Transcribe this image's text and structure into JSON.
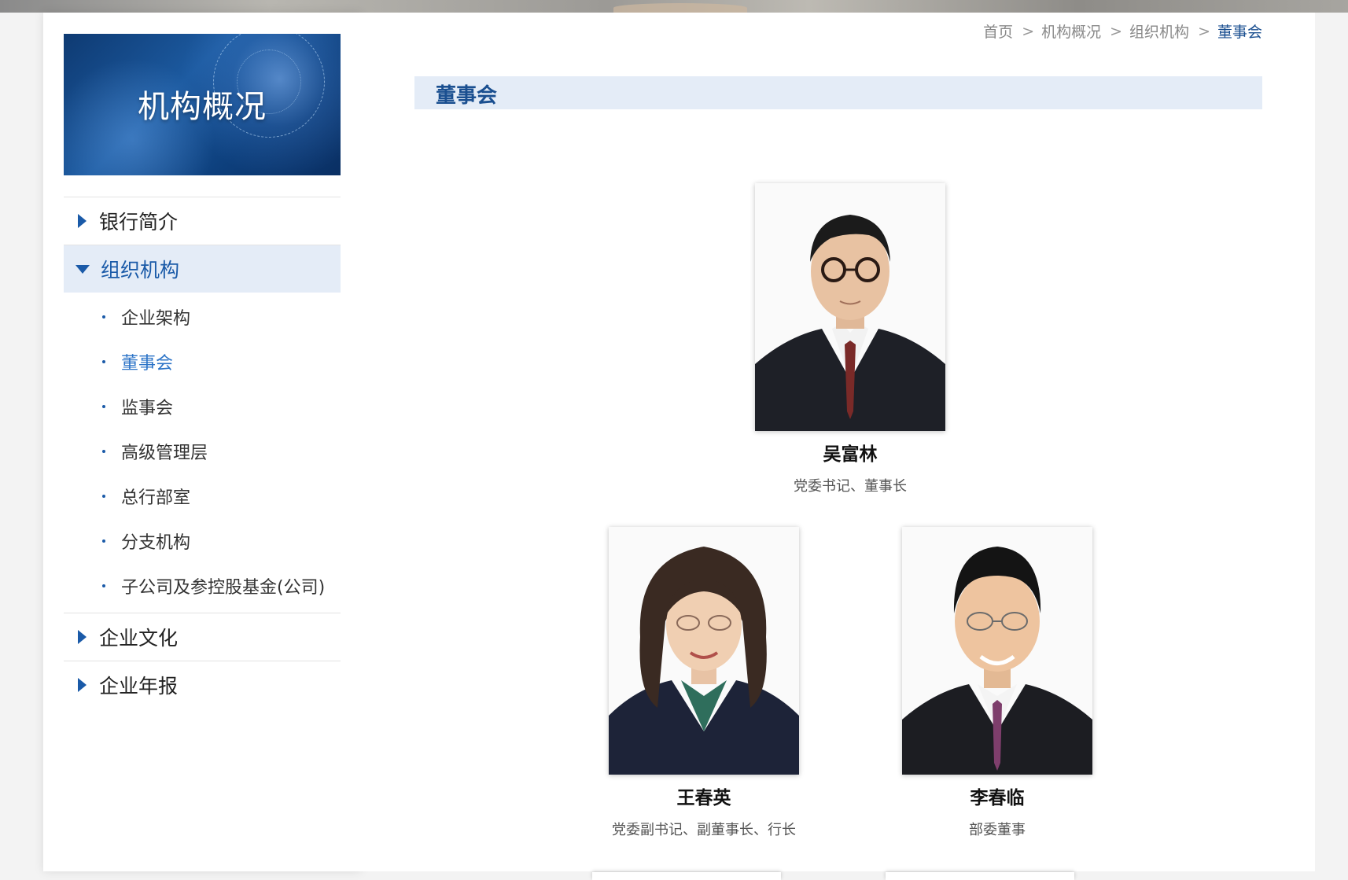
{
  "sidebar": {
    "banner_title": "机构概况",
    "nav": [
      {
        "label": "银行简介"
      },
      {
        "label": "组织机构"
      },
      {
        "label": "企业文化"
      },
      {
        "label": "企业年报"
      }
    ],
    "sub_items": [
      {
        "label": "企业架构"
      },
      {
        "label": "董事会"
      },
      {
        "label": "监事会"
      },
      {
        "label": "高级管理层"
      },
      {
        "label": "总行部室"
      },
      {
        "label": "分支机构"
      },
      {
        "label": "子公司及参控股基金(公司)"
      }
    ]
  },
  "breadcrumb": [
    "首页",
    "机构概况",
    "组织机构",
    "董事会"
  ],
  "breadcrumb_sep": ">",
  "section_title": "董事会",
  "people": [
    {
      "name": "吴富林",
      "role": "党委书记、董事长"
    },
    {
      "name": "王春英",
      "role": "党委副书记、副董事长、行长"
    },
    {
      "name": "李春临",
      "role": "部委董事"
    }
  ],
  "colors": {
    "accent": "#1a5aa8",
    "active_bg": "#e4ecf7",
    "current_link": "#2b73c7"
  }
}
